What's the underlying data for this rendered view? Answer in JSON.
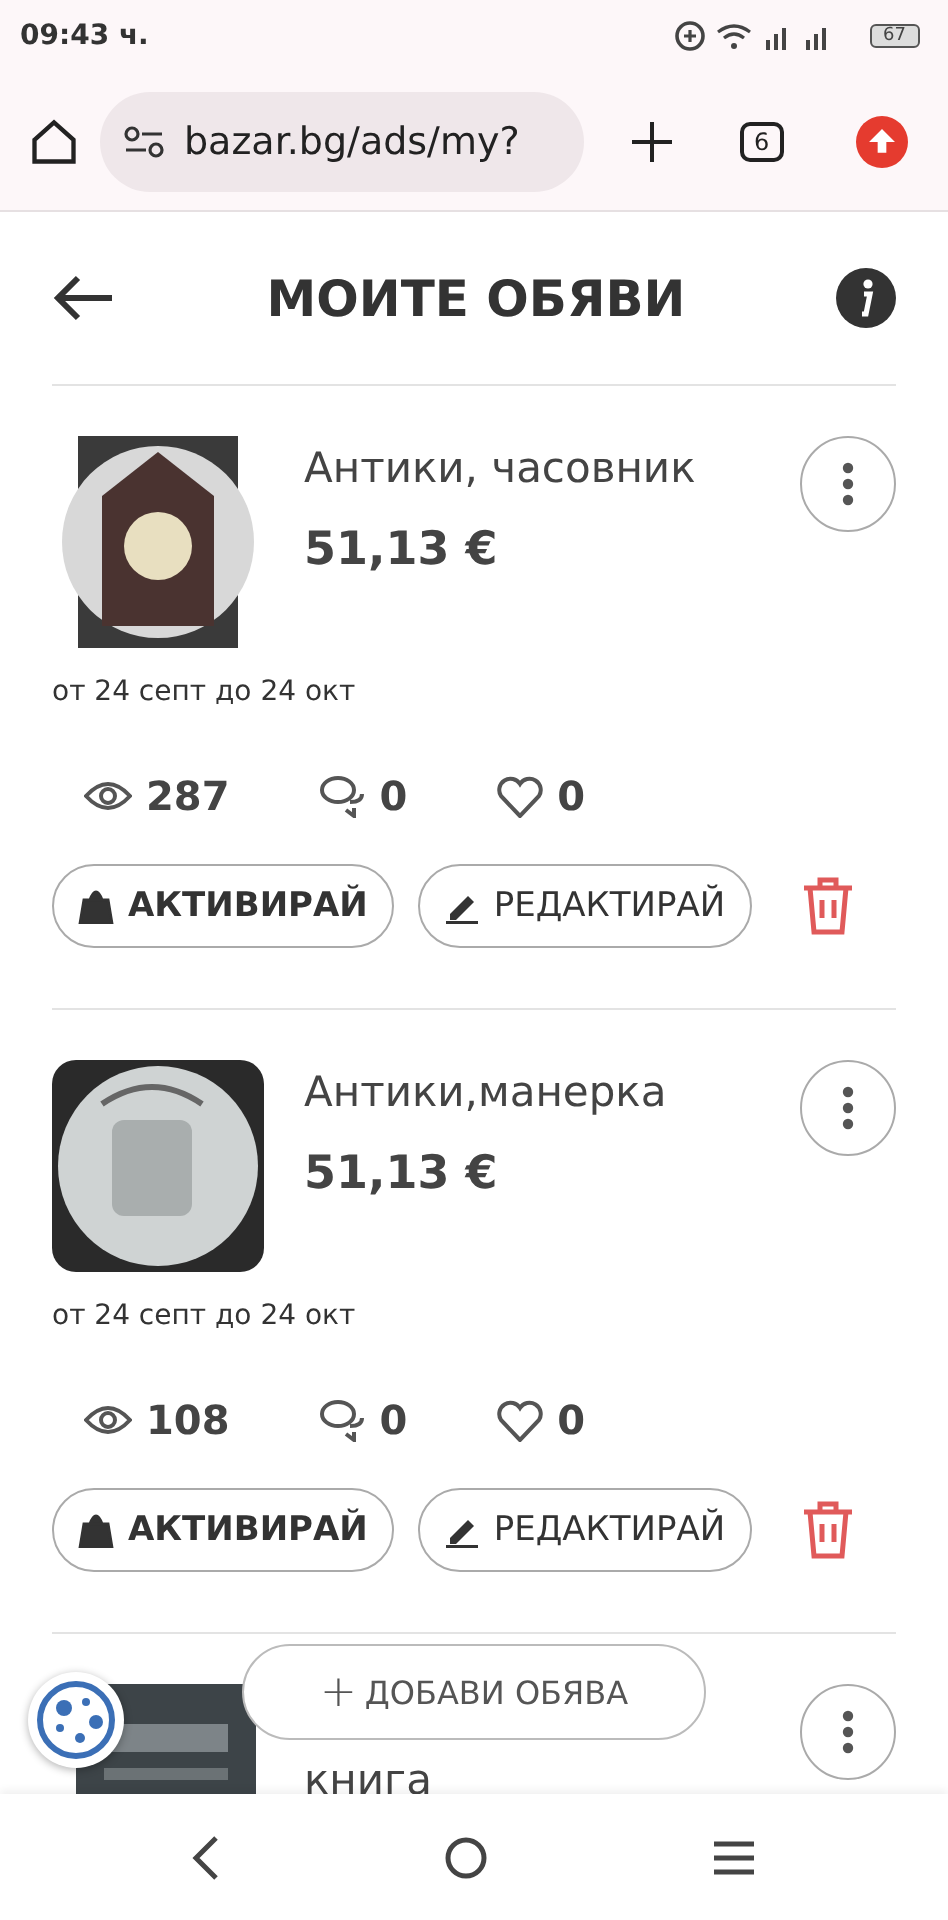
{
  "status_bar": {
    "time": "09:43 ч.",
    "battery": "67"
  },
  "browser": {
    "url": "bazar.bg/ads/my?",
    "tab_count": "6"
  },
  "header": {
    "title": "МОИТЕ ОБЯВИ"
  },
  "ads": [
    {
      "title": "Антики, часовник",
      "price": "51,13 €",
      "period": "от 24 септ до 24 окт",
      "views": "287",
      "messages": "0",
      "likes": "0",
      "activate": "АКТИВИРАЙ",
      "edit": "РЕДАКТИРАЙ"
    },
    {
      "title": "Антики,манерка",
      "price": "51,13 €",
      "period": "от 24 септ до 24 окт",
      "views": "108",
      "messages": "0",
      "likes": "0",
      "activate": "АКТИВИРАЙ",
      "edit": "РЕДАКТИРАЙ"
    },
    {
      "title": "книга"
    }
  ],
  "add_button": {
    "label": "ДОБАВИ ОБЯВА",
    "icon": "+"
  }
}
